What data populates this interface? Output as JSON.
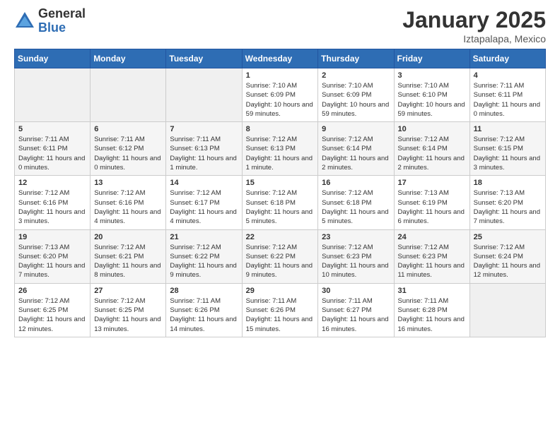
{
  "header": {
    "logo_general": "General",
    "logo_blue": "Blue",
    "month_title": "January 2025",
    "location": "Iztapalapa, Mexico"
  },
  "calendar": {
    "days_of_week": [
      "Sunday",
      "Monday",
      "Tuesday",
      "Wednesday",
      "Thursday",
      "Friday",
      "Saturday"
    ],
    "weeks": [
      {
        "cells": [
          {
            "day": "",
            "content": ""
          },
          {
            "day": "",
            "content": ""
          },
          {
            "day": "",
            "content": ""
          },
          {
            "day": "1",
            "content": "Sunrise: 7:10 AM\nSunset: 6:09 PM\nDaylight: 10 hours and 59 minutes."
          },
          {
            "day": "2",
            "content": "Sunrise: 7:10 AM\nSunset: 6:09 PM\nDaylight: 10 hours and 59 minutes."
          },
          {
            "day": "3",
            "content": "Sunrise: 7:10 AM\nSunset: 6:10 PM\nDaylight: 10 hours and 59 minutes."
          },
          {
            "day": "4",
            "content": "Sunrise: 7:11 AM\nSunset: 6:11 PM\nDaylight: 11 hours and 0 minutes."
          }
        ]
      },
      {
        "cells": [
          {
            "day": "5",
            "content": "Sunrise: 7:11 AM\nSunset: 6:11 PM\nDaylight: 11 hours and 0 minutes."
          },
          {
            "day": "6",
            "content": "Sunrise: 7:11 AM\nSunset: 6:12 PM\nDaylight: 11 hours and 0 minutes."
          },
          {
            "day": "7",
            "content": "Sunrise: 7:11 AM\nSunset: 6:13 PM\nDaylight: 11 hours and 1 minute."
          },
          {
            "day": "8",
            "content": "Sunrise: 7:12 AM\nSunset: 6:13 PM\nDaylight: 11 hours and 1 minute."
          },
          {
            "day": "9",
            "content": "Sunrise: 7:12 AM\nSunset: 6:14 PM\nDaylight: 11 hours and 2 minutes."
          },
          {
            "day": "10",
            "content": "Sunrise: 7:12 AM\nSunset: 6:14 PM\nDaylight: 11 hours and 2 minutes."
          },
          {
            "day": "11",
            "content": "Sunrise: 7:12 AM\nSunset: 6:15 PM\nDaylight: 11 hours and 3 minutes."
          }
        ]
      },
      {
        "cells": [
          {
            "day": "12",
            "content": "Sunrise: 7:12 AM\nSunset: 6:16 PM\nDaylight: 11 hours and 3 minutes."
          },
          {
            "day": "13",
            "content": "Sunrise: 7:12 AM\nSunset: 6:16 PM\nDaylight: 11 hours and 4 minutes."
          },
          {
            "day": "14",
            "content": "Sunrise: 7:12 AM\nSunset: 6:17 PM\nDaylight: 11 hours and 4 minutes."
          },
          {
            "day": "15",
            "content": "Sunrise: 7:12 AM\nSunset: 6:18 PM\nDaylight: 11 hours and 5 minutes."
          },
          {
            "day": "16",
            "content": "Sunrise: 7:12 AM\nSunset: 6:18 PM\nDaylight: 11 hours and 5 minutes."
          },
          {
            "day": "17",
            "content": "Sunrise: 7:13 AM\nSunset: 6:19 PM\nDaylight: 11 hours and 6 minutes."
          },
          {
            "day": "18",
            "content": "Sunrise: 7:13 AM\nSunset: 6:20 PM\nDaylight: 11 hours and 7 minutes."
          }
        ]
      },
      {
        "cells": [
          {
            "day": "19",
            "content": "Sunrise: 7:13 AM\nSunset: 6:20 PM\nDaylight: 11 hours and 7 minutes."
          },
          {
            "day": "20",
            "content": "Sunrise: 7:12 AM\nSunset: 6:21 PM\nDaylight: 11 hours and 8 minutes."
          },
          {
            "day": "21",
            "content": "Sunrise: 7:12 AM\nSunset: 6:22 PM\nDaylight: 11 hours and 9 minutes."
          },
          {
            "day": "22",
            "content": "Sunrise: 7:12 AM\nSunset: 6:22 PM\nDaylight: 11 hours and 9 minutes."
          },
          {
            "day": "23",
            "content": "Sunrise: 7:12 AM\nSunset: 6:23 PM\nDaylight: 11 hours and 10 minutes."
          },
          {
            "day": "24",
            "content": "Sunrise: 7:12 AM\nSunset: 6:23 PM\nDaylight: 11 hours and 11 minutes."
          },
          {
            "day": "25",
            "content": "Sunrise: 7:12 AM\nSunset: 6:24 PM\nDaylight: 11 hours and 12 minutes."
          }
        ]
      },
      {
        "cells": [
          {
            "day": "26",
            "content": "Sunrise: 7:12 AM\nSunset: 6:25 PM\nDaylight: 11 hours and 12 minutes."
          },
          {
            "day": "27",
            "content": "Sunrise: 7:12 AM\nSunset: 6:25 PM\nDaylight: 11 hours and 13 minutes."
          },
          {
            "day": "28",
            "content": "Sunrise: 7:11 AM\nSunset: 6:26 PM\nDaylight: 11 hours and 14 minutes."
          },
          {
            "day": "29",
            "content": "Sunrise: 7:11 AM\nSunset: 6:26 PM\nDaylight: 11 hours and 15 minutes."
          },
          {
            "day": "30",
            "content": "Sunrise: 7:11 AM\nSunset: 6:27 PM\nDaylight: 11 hours and 16 minutes."
          },
          {
            "day": "31",
            "content": "Sunrise: 7:11 AM\nSunset: 6:28 PM\nDaylight: 11 hours and 16 minutes."
          },
          {
            "day": "",
            "content": ""
          }
        ]
      }
    ]
  }
}
